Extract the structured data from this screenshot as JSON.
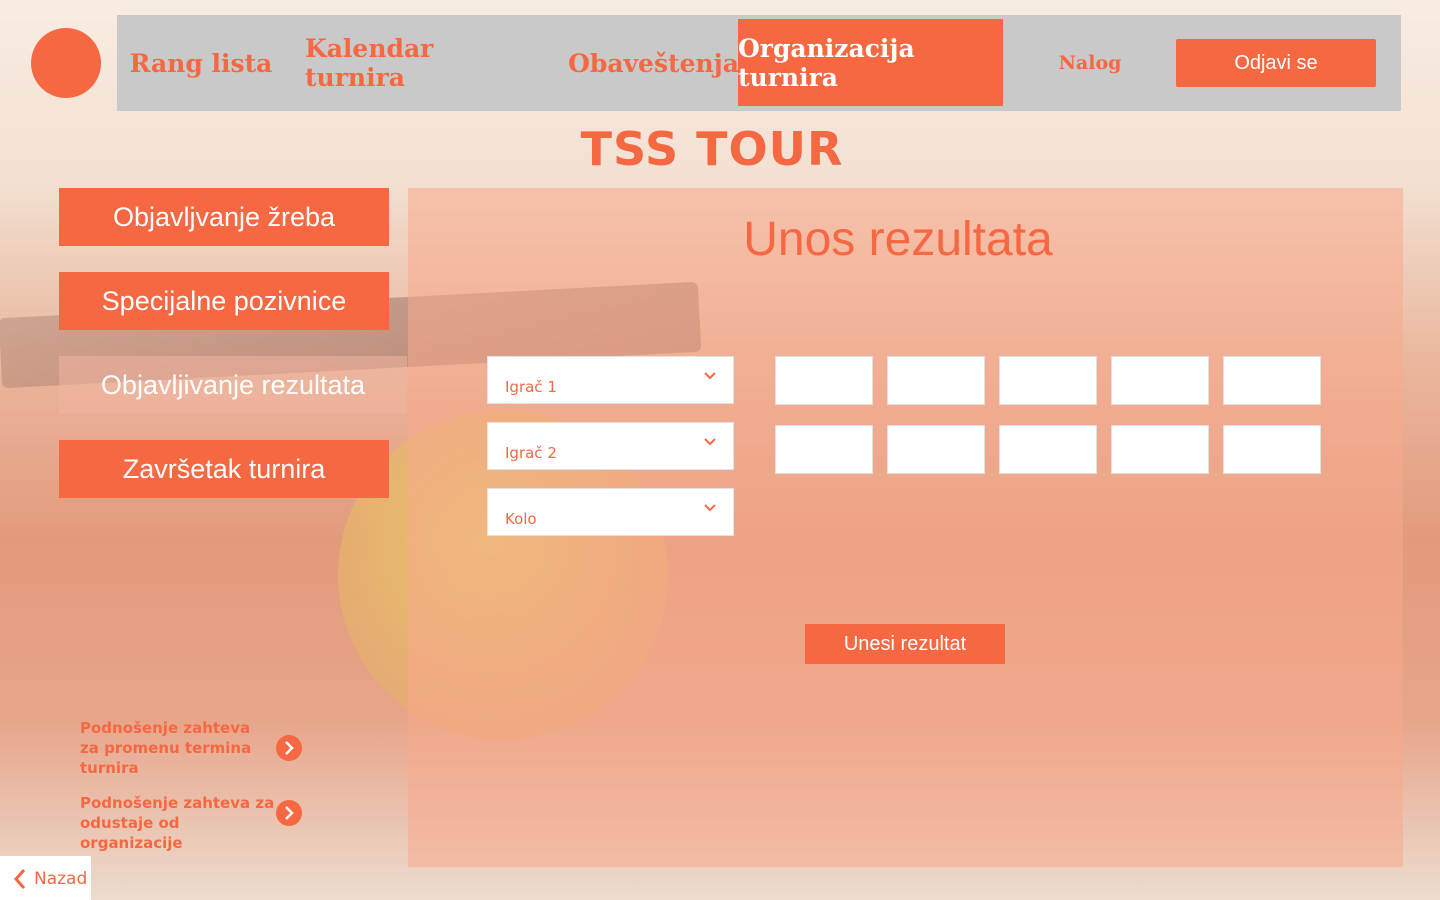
{
  "nav": {
    "items": [
      {
        "label": "Rang lista"
      },
      {
        "label": "Kalendar turnira"
      },
      {
        "label": "Obaveštenja"
      },
      {
        "label": "Organizacija turnira"
      },
      {
        "label": "Nalog"
      }
    ],
    "active": "Organizacija turnira",
    "logout_label": "Odjavi se"
  },
  "brand": {
    "title": "TSS TOUR"
  },
  "sidebar": {
    "items": [
      {
        "label": "Objavljvanje žreba"
      },
      {
        "label": "Specijalne pozivnice"
      },
      {
        "label": "Objavljivanje rezultata"
      },
      {
        "label": "Završetak turnira"
      }
    ],
    "active": "Objavljivanje rezultata"
  },
  "panel": {
    "title": "Unos rezultata",
    "selects": [
      {
        "placeholder": "Igrač 1"
      },
      {
        "placeholder": "Igrač 2"
      },
      {
        "placeholder": "Kolo"
      }
    ],
    "submit_label": "Unesi rezultat"
  },
  "requests": [
    {
      "label": "Podnošenje zahteva za promenu termina turnira"
    },
    {
      "label": "Podnošenje zahteva za odustaje od organizacije"
    }
  ],
  "back": {
    "label": "Nazad"
  },
  "icons": {
    "dropdown": "chevron-down-icon",
    "request_arrow": "chevron-right-icon",
    "back": "chevron-left-icon"
  },
  "colors": {
    "accent": "#f56842",
    "navbar": "#c9c9c9"
  }
}
